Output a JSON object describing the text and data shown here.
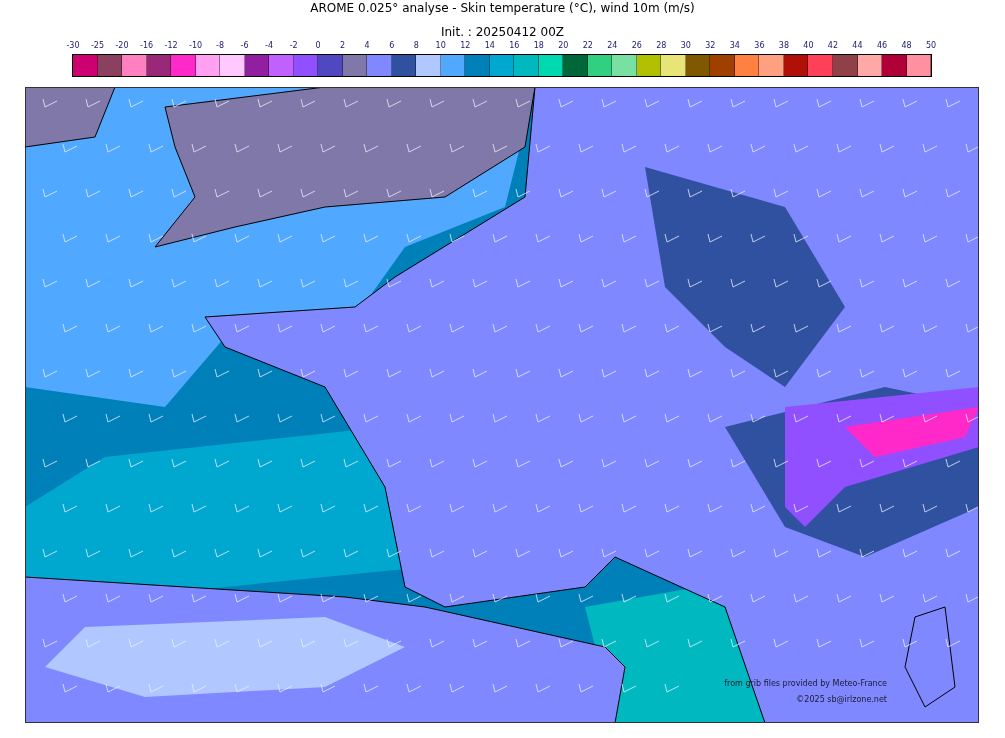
{
  "title": "AROME 0.025° analyse - Skin temperature (°C), wind 10m (m/s)",
  "subtitle": "Init. : 20250412 00Z",
  "colorbar": {
    "ticks": [
      "-30",
      "-25",
      "-20",
      "-16",
      "-12",
      "-10",
      "-8",
      "-6",
      "-4",
      "-2",
      "0",
      "2",
      "4",
      "6",
      "8",
      "10",
      "12",
      "14",
      "16",
      "18",
      "20",
      "22",
      "24",
      "26",
      "28",
      "30",
      "32",
      "34",
      "36",
      "38",
      "40",
      "42",
      "44",
      "46",
      "48",
      "50"
    ],
    "swatches": [
      {
        "color": "#cc0070"
      },
      {
        "color": "#8b4060"
      },
      {
        "color": "#ff80c0"
      },
      {
        "color": "#9a2878"
      },
      {
        "color": "#ff28c8"
      },
      {
        "color": "#ffa0f0"
      },
      {
        "color": "#ffc8ff"
      },
      {
        "color": "#9020a0"
      },
      {
        "color": "#c060ff"
      },
      {
        "color": "#9050ff"
      },
      {
        "color": "#5048c0"
      },
      {
        "color": "#8078a8"
      },
      {
        "color": "#8088ff"
      },
      {
        "color": "#3050a0"
      },
      {
        "color": "#b0c8ff"
      },
      {
        "color": "#50a8ff"
      },
      {
        "color": "#0080b8"
      },
      {
        "color": "#00a8d0"
      },
      {
        "color": "#00b8c0"
      },
      {
        "color": "#00d8b0"
      },
      {
        "color": "#006838"
      },
      {
        "color": "#30d080"
      },
      {
        "color": "#78e0a0"
      },
      {
        "color": "#b0c000"
      },
      {
        "color": "#e8e478"
      },
      {
        "color": "#805800"
      },
      {
        "color": "#a04000"
      },
      {
        "color": "#ff8040"
      },
      {
        "color": "#ffa080"
      },
      {
        "color": "#b01008"
      },
      {
        "color": "#ff4058"
      },
      {
        "color": "#904048"
      },
      {
        "color": "#ffa8a8"
      },
      {
        "color": "#b00038"
      },
      {
        "color": "#ff90a0"
      }
    ]
  },
  "map": {
    "credits": [
      "from grib files provided by Meteo-France",
      "©2025 sb@irlzone.net"
    ]
  }
}
